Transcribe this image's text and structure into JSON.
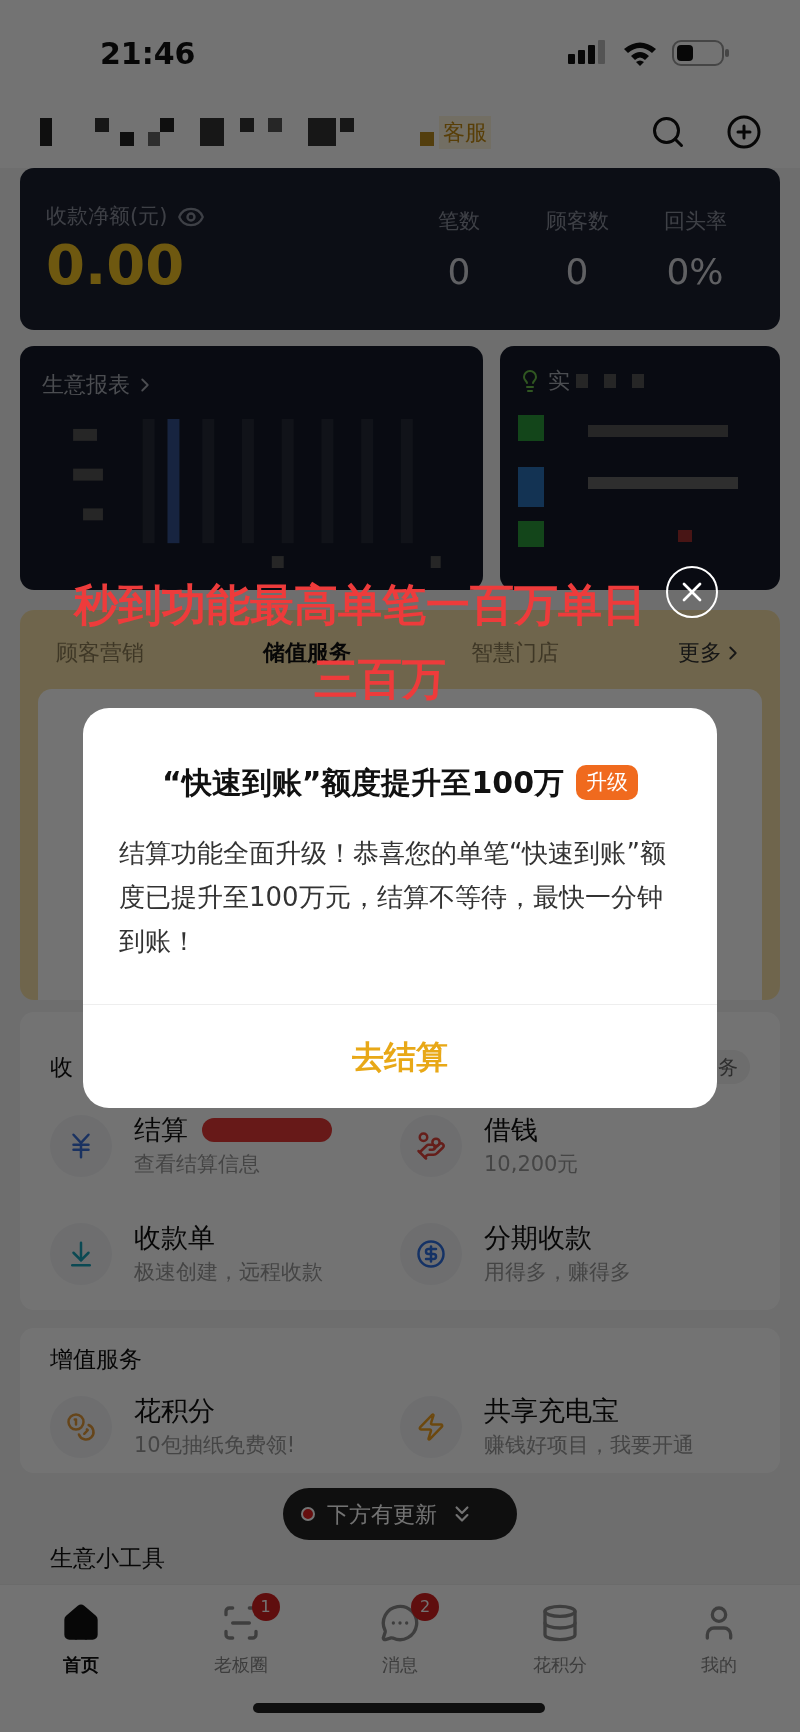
{
  "status_bar": {
    "time": "21:46"
  },
  "header": {
    "service_label": "客服"
  },
  "summary": {
    "amount_label": "收款净额(元)",
    "amount": "0.00",
    "stats": [
      {
        "label": "笔数",
        "value": "0"
      },
      {
        "label": "顾客数",
        "value": "0"
      },
      {
        "label": "回头率",
        "value": "0%"
      }
    ]
  },
  "report_card": {
    "title": "生意报表"
  },
  "live_card": {
    "title": "实"
  },
  "feature_tabs": [
    {
      "label": "顾客营销",
      "selected": false
    },
    {
      "label": "储值服务",
      "selected": true
    },
    {
      "label": "智慧门店",
      "selected": false
    }
  ],
  "feature_more": "更多",
  "collection": {
    "title": "收",
    "tag": "务",
    "items": [
      {
        "kind": "settle",
        "title": "结算",
        "subtitle": "查看结算信息",
        "promo": true
      },
      {
        "kind": "loan",
        "title": "借钱",
        "subtitle": "10,200元",
        "promo": false
      },
      {
        "kind": "bill",
        "title": "收款单",
        "subtitle": "极速创建，远程收款",
        "promo": false
      },
      {
        "kind": "installment",
        "title": "分期收款",
        "subtitle": "用得多，赚得多",
        "promo": false
      }
    ]
  },
  "value_added": {
    "title": "增值服务",
    "items": [
      {
        "kind": "points",
        "title": "花积分",
        "subtitle": "10包抽纸免费领!"
      },
      {
        "kind": "power",
        "title": "共享充电宝",
        "subtitle": "赚钱好项目，我要开通"
      }
    ]
  },
  "update_pill": {
    "text": "下方有更新"
  },
  "tools": {
    "title": "生意小工具"
  },
  "tab_bar": [
    {
      "kind": "home",
      "label": "首页",
      "selected": true
    },
    {
      "kind": "circle",
      "label": "老板圈",
      "selected": false,
      "badge": "1"
    },
    {
      "kind": "message",
      "label": "消息",
      "selected": false,
      "badge": "2"
    },
    {
      "kind": "points",
      "label": "花积分",
      "selected": false
    },
    {
      "kind": "me",
      "label": "我的",
      "selected": false
    }
  ],
  "annotation": {
    "lines": [
      "秒到功能最高单笔一百万单日",
      "三百万"
    ]
  },
  "modal": {
    "title": "“快速到账”额度提升至100万",
    "tag": "升级",
    "body": "结算功能全面升级！恭喜您的单笔“快速到账”额度已提升至100万元，结算不等待，最快一分钟到账！",
    "action": "去结算"
  }
}
